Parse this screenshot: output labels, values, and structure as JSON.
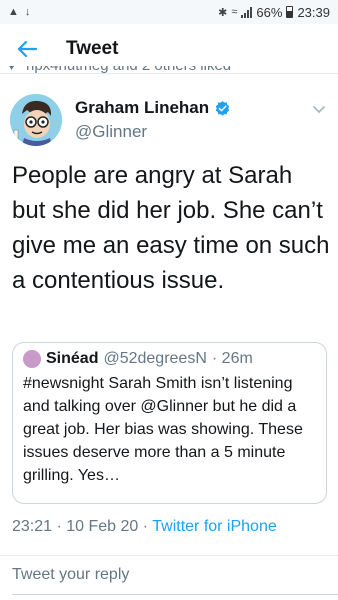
{
  "status_bar": {
    "battery": "66%",
    "time": "23:39"
  },
  "header": {
    "title": "Tweet"
  },
  "liked_by": "hpx4nutmeg and 2 others liked",
  "tweet": {
    "author_name": "Graham Linehan",
    "author_handle": "@Glinner",
    "text": "People are angry at Sarah but she did her job.  She can’t give me an easy time on such a contentious issue.",
    "timestamp": "23:21 · 10 Feb 20 · ",
    "source": "Twitter for iPhone"
  },
  "quoted_tweet": {
    "author_name": "Sinéad",
    "author_handle": "@52degreesN",
    "age": "· 26m",
    "text": "#newsnight Sarah Smith isn’t listening and talking over @Glinner but he did a great job. Her bias was showing. These issues deserve more than a 5 minute grilling. Yes…"
  },
  "reply": {
    "placeholder": "Tweet your reply"
  },
  "colors": {
    "accent": "#1da1f2",
    "secondary_text": "#657786",
    "primary_text": "#14171a"
  }
}
